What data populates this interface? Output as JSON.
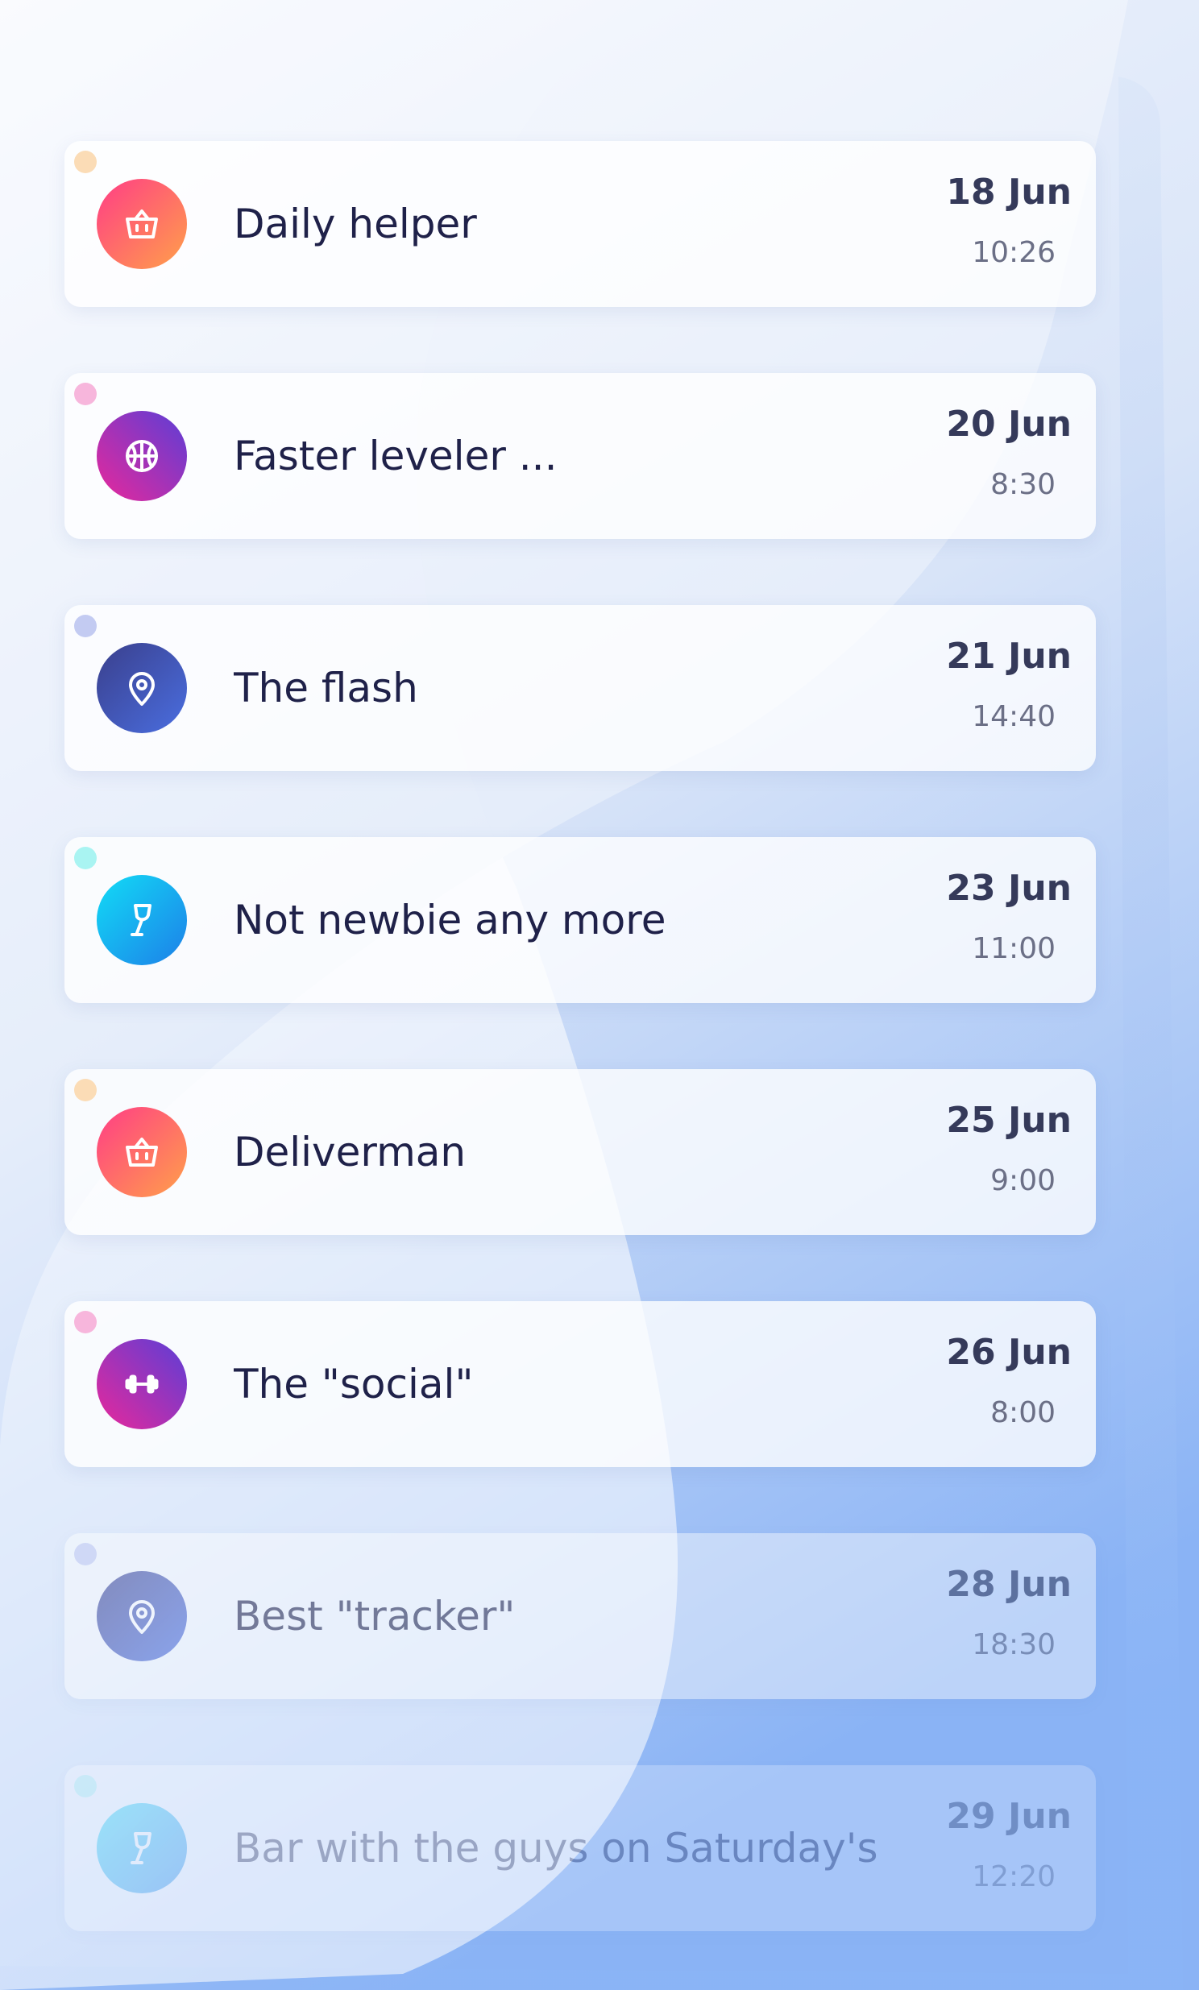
{
  "colors": {
    "card_bg": "#ffffff",
    "title_text": "#1f2149",
    "date_text": "#353a5a",
    "time_text": "#6b6f86",
    "background_top": "#f3f6fc",
    "background_bottom": "#8ab3f5"
  },
  "items": [
    {
      "title": "Daily helper",
      "date": "18 Jun",
      "time": "10:26",
      "icon": "basket-icon",
      "dot_color": "#fbdcb6",
      "gradient": [
        "#ff3d86",
        "#ffa04a"
      ]
    },
    {
      "title": "Faster leveler ...",
      "date": "20 Jun",
      "time": "8:30",
      "icon": "basketball-icon",
      "dot_color": "#f7b6dc",
      "gradient": [
        "#e8289b",
        "#5b3ed6"
      ]
    },
    {
      "title": "The flash",
      "date": "21 Jun",
      "time": "14:40",
      "icon": "location-pin-icon",
      "dot_color": "#c3cbf2",
      "gradient": [
        "#3a3f8c",
        "#4a6ee0"
      ]
    },
    {
      "title": "Not newbie any more",
      "date": "23 Jun",
      "time": "11:00",
      "icon": "wine-glass-icon",
      "dot_color": "#a9f4f2",
      "gradient": [
        "#12dcf6",
        "#1d7fe8"
      ]
    },
    {
      "title": "Deliverman",
      "date": "25 Jun",
      "time": "9:00",
      "icon": "basket-icon",
      "dot_color": "#fbdcb6",
      "gradient": [
        "#ff3d86",
        "#ffa04a"
      ]
    },
    {
      "title": "The \"social\"",
      "date": "26 Jun",
      "time": "8:00",
      "icon": "dumbbell-icon",
      "dot_color": "#f7b6dc",
      "gradient": [
        "#e8289b",
        "#5b3ed6"
      ]
    },
    {
      "title": "Best \"tracker\"",
      "date": "28 Jun",
      "time": "18:30",
      "icon": "location-pin-icon",
      "dot_color": "#c3cbf2",
      "gradient": [
        "#3a3f8c",
        "#4a6ee0"
      ]
    },
    {
      "title": "Bar with the guys on Saturday's ...",
      "date": "29 Jun",
      "time": "12:20",
      "icon": "wine-glass-icon",
      "dot_color": "#a9f4f2",
      "gradient": [
        "#12dcf6",
        "#1d7fe8"
      ]
    }
  ]
}
